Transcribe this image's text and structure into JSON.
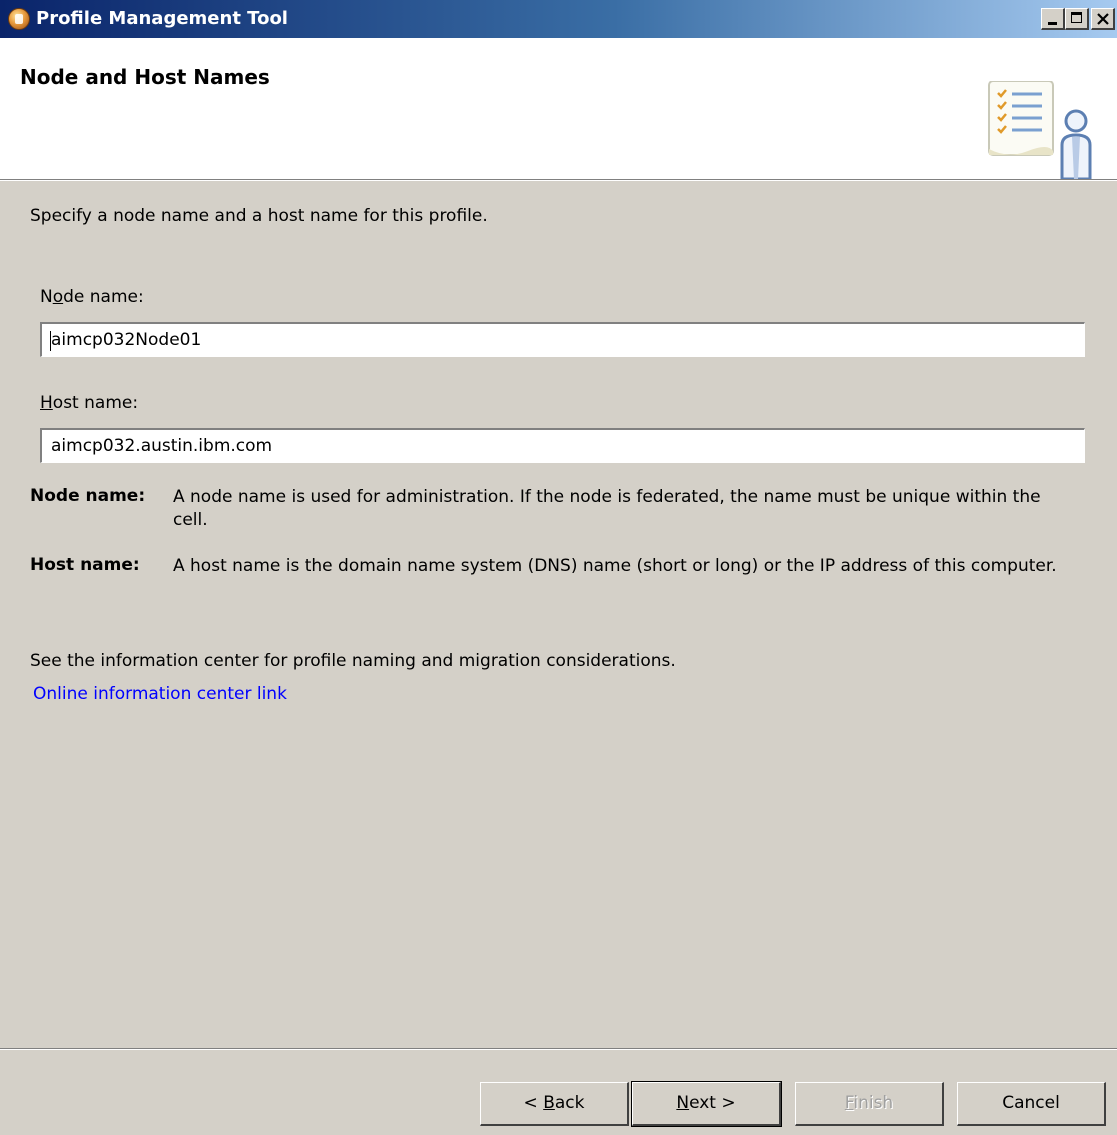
{
  "window": {
    "title": "Profile Management Tool"
  },
  "header": {
    "title": "Node and Host Names"
  },
  "main": {
    "description": "Specify a node name and a host name for this profile.",
    "node_name": {
      "label_pre": "N",
      "label_mnemonic": "o",
      "label_post": "de name:",
      "value": "aimcp032Node01"
    },
    "host_name": {
      "label_pre": "",
      "label_mnemonic": "H",
      "label_post": "ost name:",
      "value": "aimcp032.austin.ibm.com"
    },
    "help": [
      {
        "term": "Node name:",
        "text": "A node name is used for administration. If the node is federated, the name must be unique within the cell."
      },
      {
        "term": "Host name:",
        "text": "A host name is the domain name system (DNS) name (short or long) or the IP address of this computer."
      }
    ],
    "info_note": "See the information center for profile naming and migration considerations.",
    "info_link": "Online information center link"
  },
  "buttons": {
    "back": {
      "pre": "< ",
      "mnemonic": "B",
      "post": "ack"
    },
    "next": {
      "pre": "",
      "mnemonic": "N",
      "post": "ext >"
    },
    "finish": {
      "pre": "",
      "mnemonic": "F",
      "post": "inish",
      "enabled": false
    },
    "cancel": {
      "label": "Cancel"
    }
  },
  "colors": {
    "window_background": "#d4d0c8",
    "title_bar_start": "#0a246a",
    "title_bar_end": "#a6caf0",
    "link": "#0000ff"
  },
  "icons": {
    "app": "profile-tool-icon",
    "header_graphic": "checklist-person-icon",
    "minimize": "minimize-icon",
    "maximize": "maximize-icon",
    "close": "close-icon"
  }
}
